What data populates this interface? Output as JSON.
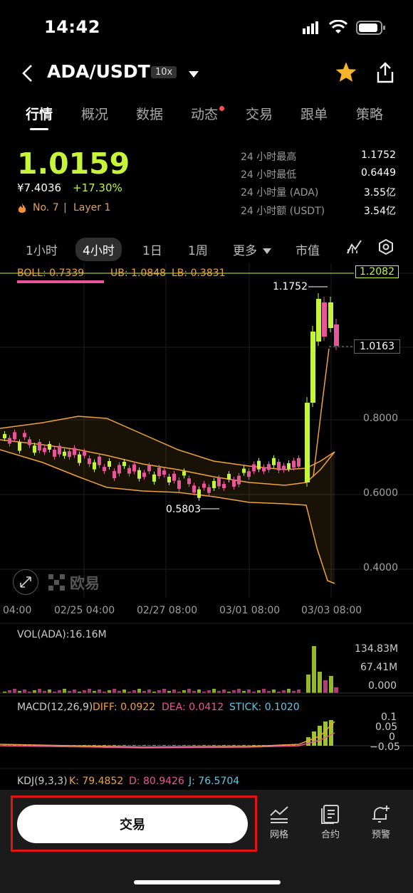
{
  "status": {
    "time": "14:42"
  },
  "header": {
    "pair": "ADA/USDT",
    "leverage": "10x"
  },
  "tabs": [
    "行情",
    "概况",
    "数据",
    "动态",
    "交易",
    "跟单",
    "策略"
  ],
  "ticker": {
    "price": "1.0159",
    "cny": "¥7.4036",
    "change": "+17.30%",
    "rank": "No. 7",
    "tag": "Layer 1",
    "stats": [
      {
        "label": "24 小时最高",
        "value": "1.1752"
      },
      {
        "label": "24 小时最低",
        "value": "0.6449"
      },
      {
        "label": "24 小时量 (ADA)",
        "value": "3.55亿"
      },
      {
        "label": "24 小时额 (USDT)",
        "value": "3.54亿"
      }
    ]
  },
  "intervals": [
    "1小时",
    "4小时",
    "1日",
    "1周",
    "更多",
    "市值"
  ],
  "boll": {
    "boll": "BOLL: 0.7339",
    "ub": "UB: 1.0848",
    "lb": "LB: 0.3831"
  },
  "price_axis": {
    "top": "1.2082",
    "current": "1.0163",
    "p080": "0.8000",
    "p060": "0.6000",
    "p040": "0.4000"
  },
  "price_notes": {
    "high": "1.1752",
    "low": "0.5803"
  },
  "watermark": "欧易",
  "time_axis": [
    "04:00",
    "02/25 04:00",
    "02/27 08:00",
    "03/01 08:00",
    "03/03 08:00"
  ],
  "vol": {
    "label": "VOL(ADA):16.16M",
    "max": "134.83M",
    "mid": "67.41M",
    "zero": "0.000"
  },
  "macd": {
    "label": "MACD(12,26,9)",
    "diff": "DIFF: 0.0922",
    "dea": "DEA: 0.0412",
    "stick": "STICK: 0.1020",
    "a1": "0.1",
    "a2": "0.05",
    "a3": "0",
    "a4": "−0.05"
  },
  "kdj": {
    "label": "KDJ(9,3,3)",
    "k": "K: 79.4852",
    "d": "D: 80.9426",
    "j": "J: 76.5704"
  },
  "bottom": {
    "trade": "交易",
    "tools": [
      "网格",
      "合约",
      "预警"
    ]
  },
  "colors": {
    "up": "#c6f43a",
    "down": "#e8559b",
    "accent": "#f0a33a",
    "highlight": "#e01515"
  }
}
